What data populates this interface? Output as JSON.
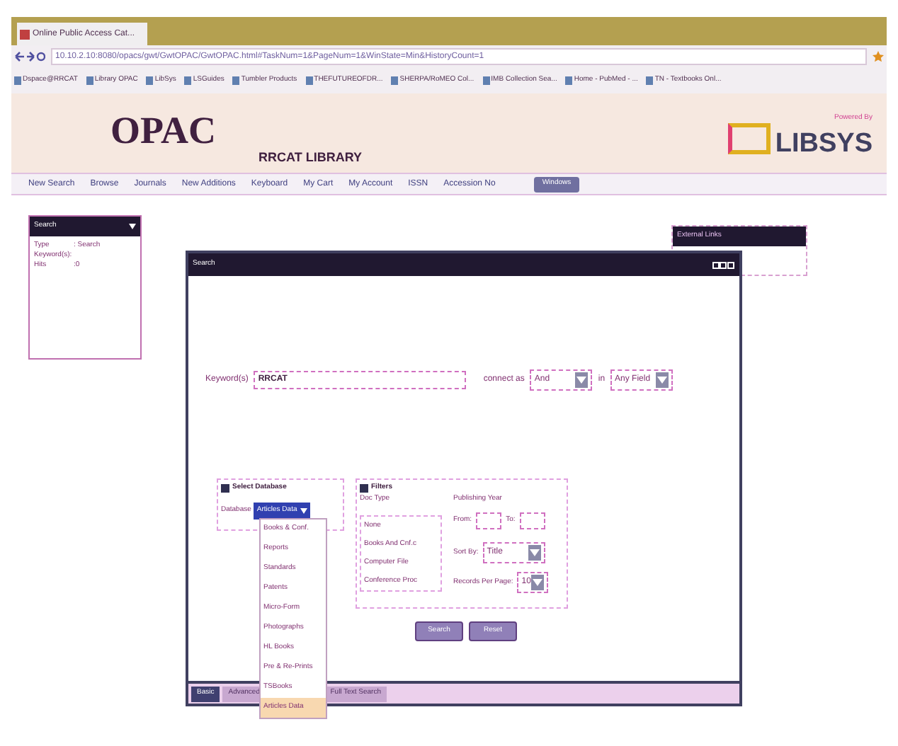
{
  "browser": {
    "tab_title": "Online Public Access Cat...",
    "url": "10.10.2.10:8080/opacs/gwt/GwtOPAC/GwtOPAC.html#TaskNum=1&PageNum=1&WinState=Min&HistoryCount=1",
    "bookmarks": [
      "Dspace@RRCAT",
      "Library OPAC",
      "LibSys",
      "LSGuides",
      "Tumbler Products",
      "THEFUTUREOFDR...",
      "SHERPA/RoMEO Col...",
      "IMB Collection Sea...",
      "Home - PubMed - ...",
      "TN - Textbooks Onl..."
    ]
  },
  "header": {
    "logo": "OPAC",
    "library": "RRCAT LIBRARY",
    "powered_by": "Powered By",
    "brand": "LIBSYS"
  },
  "menu": [
    {
      "label": "New Search",
      "kind": "link"
    },
    {
      "label": "Browse",
      "kind": "link"
    },
    {
      "label": "Journals",
      "kind": "link"
    },
    {
      "label": "New Additions",
      "kind": "link"
    },
    {
      "label": "Keyboard",
      "kind": "link"
    },
    {
      "label": "My Cart",
      "kind": "link"
    },
    {
      "label": "My Account",
      "kind": "link"
    },
    {
      "label": "ISSN",
      "kind": "link"
    },
    {
      "label": "Accession No",
      "kind": "link"
    },
    {
      "label": "Windows",
      "kind": "button"
    }
  ],
  "history_panel": {
    "title": "Search",
    "rows": [
      {
        "label": "Type",
        "value": ": Search"
      },
      {
        "label": "Keyword(s):",
        "value": ""
      },
      {
        "label": "Hits",
        "value": ":0"
      }
    ]
  },
  "external_links": {
    "title": "External Links"
  },
  "dialog": {
    "title": "Search",
    "keyword_label": "Keyword(s)",
    "keyword_value": "RRCAT",
    "connect_label": "connect as",
    "connect_value": "And",
    "in_label": "in",
    "field_value": "Any Field",
    "database": {
      "title": "Select Database",
      "label": "Database",
      "value": "Articles Data",
      "options": [
        {
          "label": "Books & Conf.",
          "selected": false
        },
        {
          "label": "Reports",
          "selected": false
        },
        {
          "label": "Standards",
          "selected": false
        },
        {
          "label": "Patents",
          "selected": false
        },
        {
          "label": "Micro-Form",
          "selected": false
        },
        {
          "label": "Photographs",
          "selected": false
        },
        {
          "label": "HL Books",
          "selected": false
        },
        {
          "label": "Pre & Re-Prints",
          "selected": false
        },
        {
          "label": "TSBooks",
          "selected": false
        },
        {
          "label": "Articles Data",
          "selected": true
        }
      ]
    },
    "filters": {
      "title": "Filters",
      "doc_type_label": "Doc Type",
      "doc_types": [
        "None",
        "Books And Cnf.c",
        "Computer File",
        "Conference Proc"
      ],
      "year_label": "Publishing Year",
      "from_label": "From:",
      "to_label": "To:",
      "sort_label": "Sort By:",
      "sort_value": "Title",
      "records_label": "Records Per Page:",
      "records_value": "10"
    },
    "buttons": [
      "Search",
      "Reset"
    ],
    "tabs": [
      {
        "label": "Basic",
        "selected": true
      },
      {
        "label": "Advanced",
        "selected": false
      },
      {
        "label": "Full Text Search",
        "selected": false
      }
    ]
  }
}
